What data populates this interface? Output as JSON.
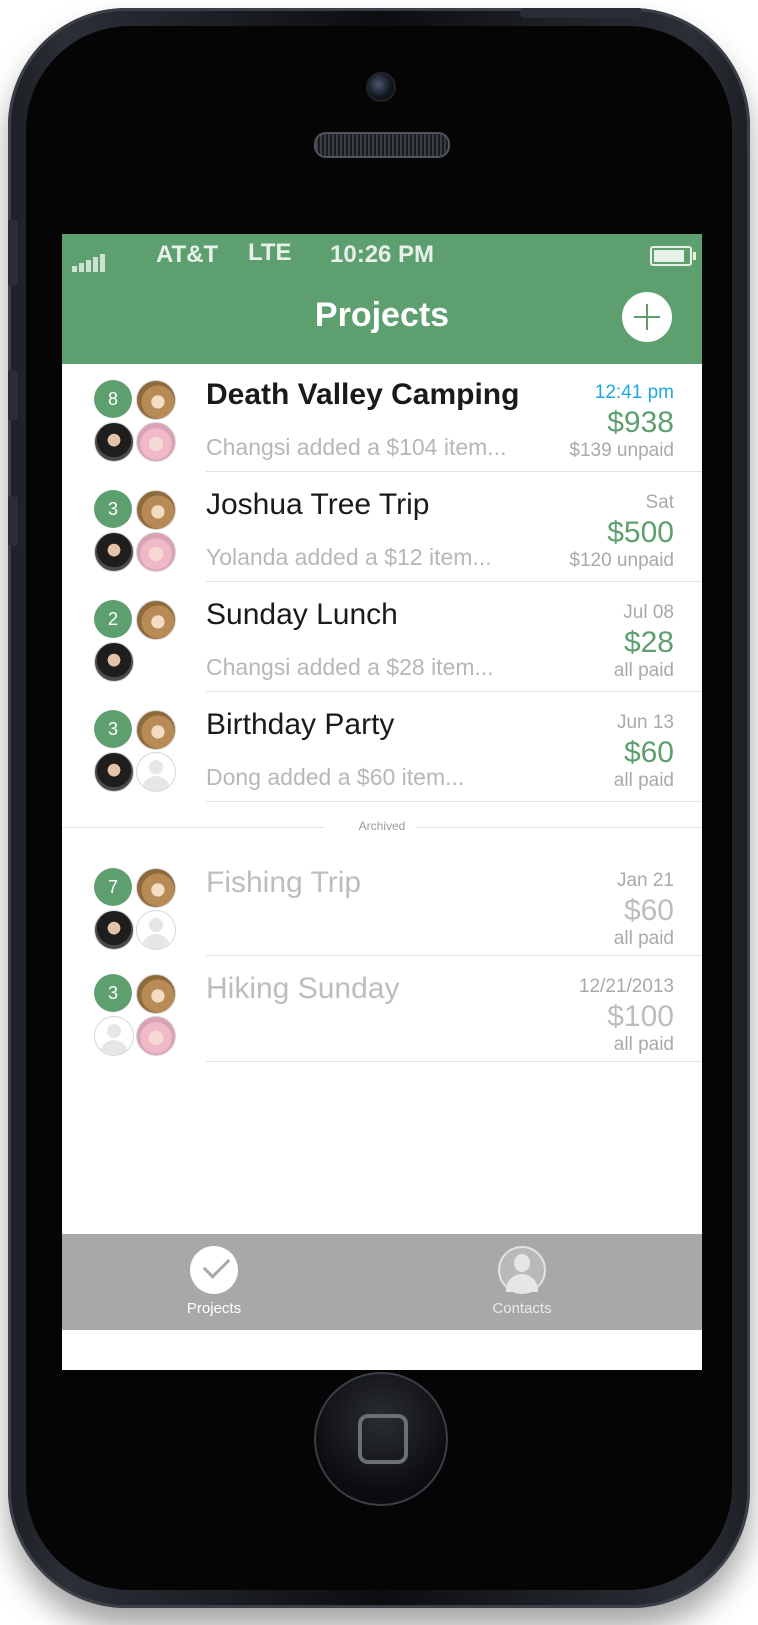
{
  "status_bar": {
    "carrier": "AT&T",
    "network": "LTE",
    "time": "10:26 PM"
  },
  "header": {
    "title": "Projects",
    "add_icon": "plus-icon"
  },
  "projects": [
    {
      "title": "Death Valley Camping",
      "count": "8",
      "subtitle": "Changsi added a $104 item...",
      "date": "12:41 pm",
      "amount": "$938",
      "status": "$139 unpaid"
    },
    {
      "title": "Joshua Tree Trip",
      "count": "3",
      "subtitle": "Yolanda added a $12 item...",
      "date": "Sat",
      "amount": "$500",
      "status": "$120 unpaid"
    },
    {
      "title": "Sunday Lunch",
      "count": "2",
      "subtitle": "Changsi added a $28 item...",
      "date": "Jul 08",
      "amount": "$28",
      "status": "all paid"
    },
    {
      "title": "Birthday Party",
      "count": "3",
      "subtitle": "Dong added a $60 item...",
      "date": "Jun 13",
      "amount": "$60",
      "status": "all paid"
    }
  ],
  "archived_label": "Archived",
  "archived": [
    {
      "title": "Fishing Trip",
      "count": "7",
      "date": "Jan 21",
      "amount": "$60",
      "status": "all paid"
    },
    {
      "title": "Hiking Sunday",
      "count": "3",
      "date": "12/21/2013",
      "amount": "$100",
      "status": "all paid"
    }
  ],
  "tabs": [
    {
      "label": "Projects",
      "icon": "checkmark-icon"
    },
    {
      "label": "Contacts",
      "icon": "person-icon"
    }
  ],
  "colors": {
    "accent": "#5e9f6f",
    "recent_date": "#1ea7e0",
    "tabbar": "#a8a8a8"
  }
}
